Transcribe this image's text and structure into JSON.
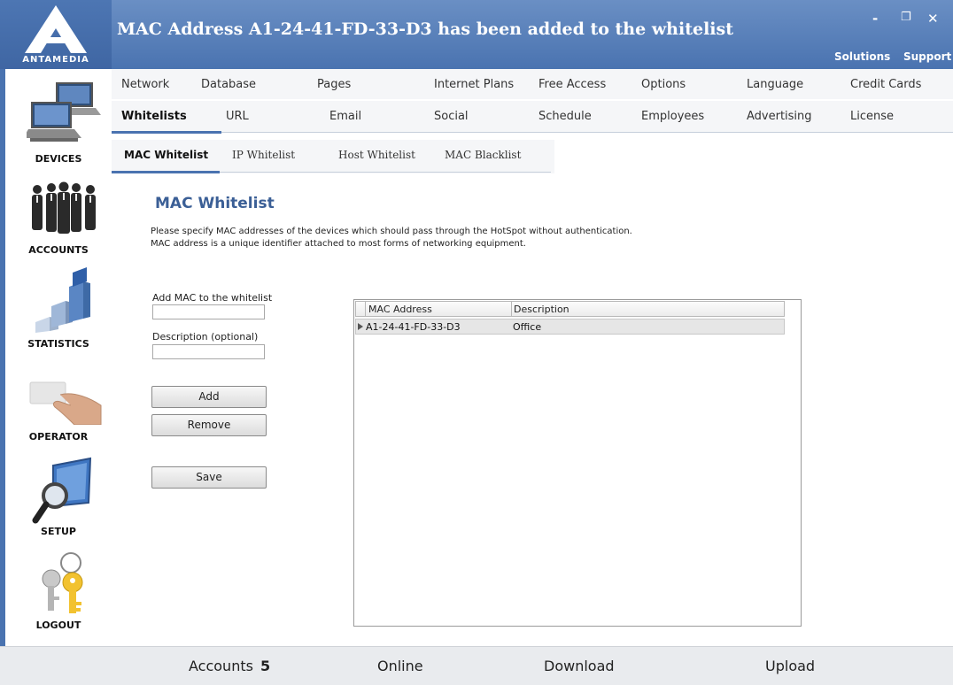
{
  "app": {
    "brand": "ANTAMEDIA",
    "title": "MAC Address A1-24-41-FD-33-D3 has been added to the whitelist",
    "links": {
      "solutions": "Solutions",
      "support": "Support"
    },
    "window_buttons": {
      "minimize": "-",
      "restore": "❐",
      "close": "✕"
    }
  },
  "sidebar": {
    "items": [
      {
        "label": "DEVICES",
        "icon": "devices-icon"
      },
      {
        "label": "ACCOUNTS",
        "icon": "accounts-icon"
      },
      {
        "label": "STATISTICS",
        "icon": "statistics-icon"
      },
      {
        "label": "OPERATOR",
        "icon": "operator-icon"
      },
      {
        "label": "SETUP",
        "icon": "setup-icon"
      },
      {
        "label": "LOGOUT",
        "icon": "logout-icon"
      }
    ]
  },
  "menu": {
    "row1": [
      "Network",
      "Database",
      "Pages",
      "Internet Plans",
      "Free Access",
      "Options",
      "Language",
      "Credit Cards"
    ],
    "row2": [
      "Whitelists",
      "URL",
      "Email",
      "Social",
      "Schedule",
      "Employees",
      "Advertising",
      "License"
    ],
    "active": "Whitelists"
  },
  "subtabs": {
    "items": [
      "MAC Whitelist",
      "IP Whitelist",
      "Host Whitelist",
      "MAC Blacklist"
    ],
    "active": "MAC Whitelist"
  },
  "content": {
    "heading": "MAC Whitelist",
    "desc_line1": "Please specify MAC addresses of the devices which should pass through the HotSpot without authentication.",
    "desc_line2": "MAC address is a unique identifier attached to most forms of networking equipment.",
    "add_mac_label": "Add MAC to the whitelist",
    "add_mac_value": "",
    "description_label": "Description (optional)",
    "description_value": "",
    "buttons": {
      "add": "Add",
      "remove": "Remove",
      "save": "Save"
    }
  },
  "grid": {
    "columns": [
      "MAC Address",
      "Description"
    ],
    "rows": [
      {
        "mac": "A1-24-41-FD-33-D3",
        "description": "Office"
      }
    ]
  },
  "status": {
    "accounts_label": "Accounts",
    "accounts_count": "5",
    "online_label": "Online",
    "download_label": "Download",
    "upload_label": "Upload"
  },
  "colors": {
    "accent": "#4a73b0",
    "heading": "#3b5f96"
  }
}
